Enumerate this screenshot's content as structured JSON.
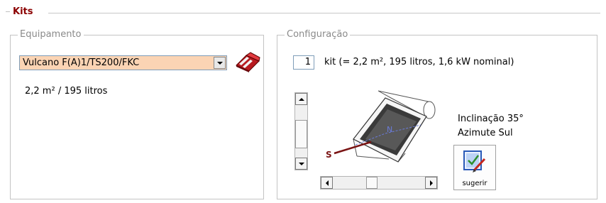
{
  "section_title": "Kits",
  "equipment": {
    "legend": "Equipamento",
    "selected": "Vulcano F(A)1/TS200/FKC",
    "info": "2,2 m² / 195 litros"
  },
  "configuration": {
    "legend": "Configuração",
    "quantity": "1",
    "kit_description": "kit  (= 2,2 m², 195 litros, 1,6 kW nominal)",
    "diagram": {
      "north_label": "N",
      "south_label": "S"
    },
    "inclination": "Inclinação 35°",
    "azimuth": "Azimute Sul",
    "suggest_label": "sugerir"
  },
  "colors": {
    "title": "#8b0000",
    "select_bg": "#fbd4b4",
    "icon_red": "#d9262b",
    "south_rod": "#7a1414",
    "north_axis": "#6a7bd8"
  },
  "icons": [
    "kit-box-icon",
    "suggest-icon",
    "chevron-down-icon",
    "arrow-up-icon",
    "arrow-down-icon",
    "arrow-left-icon",
    "arrow-right-icon"
  ]
}
